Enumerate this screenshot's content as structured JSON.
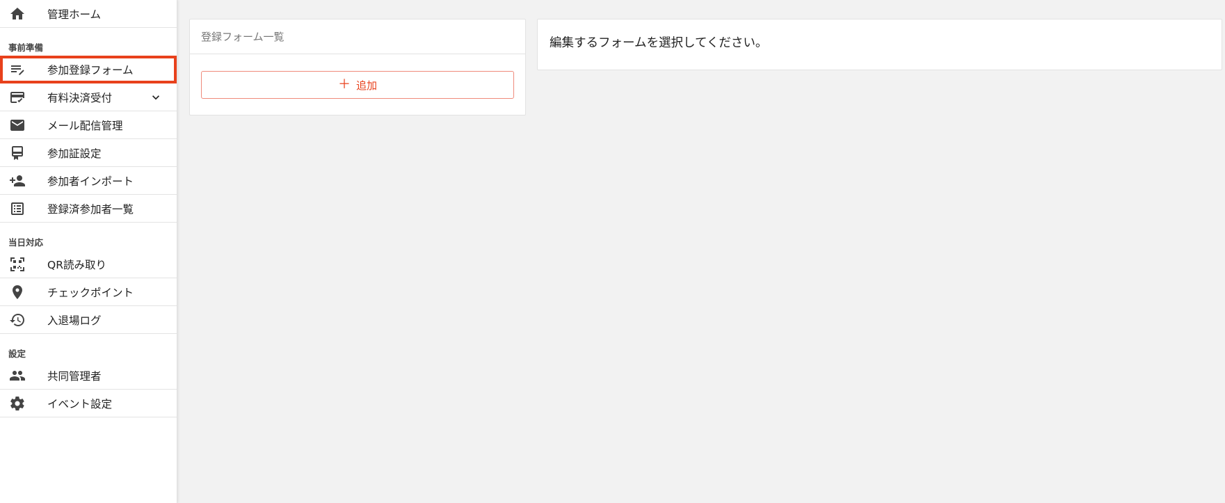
{
  "sidebar": {
    "home": {
      "label": "管理ホーム",
      "icon": "home-icon"
    },
    "sections": [
      {
        "title": "事前準備",
        "items": [
          {
            "label": "参加登録フォーム",
            "icon": "edit-note-icon",
            "selected": true
          },
          {
            "label": "有料決済受付",
            "icon": "credit-card-check-icon",
            "expandable": true
          },
          {
            "label": "メール配信管理",
            "icon": "mail-icon"
          },
          {
            "label": "参加証設定",
            "icon": "badge-icon"
          },
          {
            "label": "参加者インポート",
            "icon": "person-add-icon"
          },
          {
            "label": "登録済参加者一覧",
            "icon": "list-icon"
          }
        ]
      },
      {
        "title": "当日対応",
        "items": [
          {
            "label": "QR読み取り",
            "icon": "qr-scan-icon"
          },
          {
            "label": "チェックポイント",
            "icon": "location-pin-icon"
          },
          {
            "label": "入退場ログ",
            "icon": "history-icon"
          }
        ]
      },
      {
        "title": "設定",
        "items": [
          {
            "label": "共同管理者",
            "icon": "people-icon"
          },
          {
            "label": "イベント設定",
            "icon": "gear-icon"
          }
        ]
      }
    ]
  },
  "form_list": {
    "title": "登録フォーム一覧",
    "add_label": "追加",
    "add_icon": "plus-icon"
  },
  "editor": {
    "message": "編集するフォームを選択してください。"
  },
  "colors": {
    "accent": "#e8411c",
    "accent_border": "#ef8a7b",
    "background": "#f2f2f2"
  }
}
